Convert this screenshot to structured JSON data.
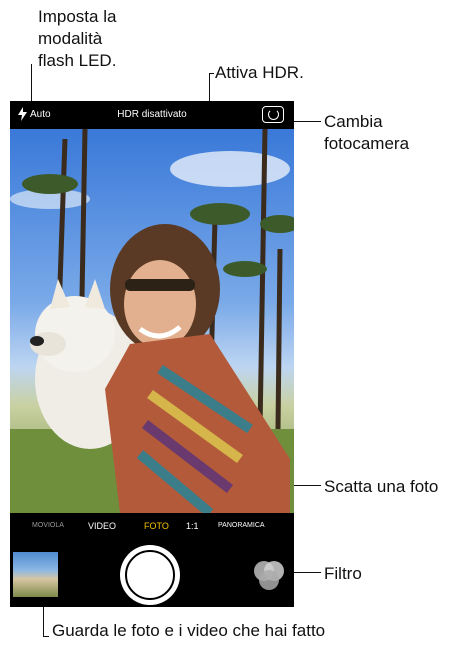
{
  "callouts": {
    "flash": "Imposta la\nmodalità\nflash LED.",
    "hdr": "Attiva HDR.",
    "switch_camera": "Cambia\nfotocamera",
    "shutter": "Scatta una foto",
    "filter": "Filtro",
    "gallery": "Guarda le foto e i video che hai fatto"
  },
  "camera": {
    "flash_mode": "Auto",
    "hdr_status": "HDR disattivato",
    "modes": [
      "MOVIOLA",
      "VIDEO",
      "FOTO",
      "1:1",
      "PANORAMICA"
    ],
    "selected_mode": "FOTO",
    "accent_color": "#f5c300"
  },
  "icons": {
    "flash": "lightning-bolt-icon",
    "switch_camera": "camera-rotate-icon",
    "filters": "three-circles-icon"
  }
}
